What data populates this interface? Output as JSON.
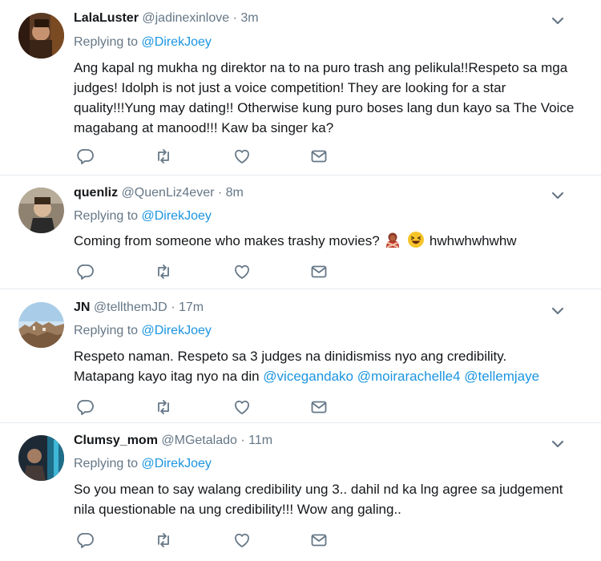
{
  "tweets": [
    {
      "name": "LalaLuster",
      "handle": "@jadinexinlove",
      "separator": "·",
      "time": "3m",
      "replying_prefix": "Replying to",
      "replying_to": "@DirekJoey",
      "text": "Ang kapal ng mukha ng direktor na to na puro trash ang pelikula!!Respeto sa mga judges! Idolph is not just a voice competition! They are looking for a star quality!!!Yung may dating!! Otherwise kung puro boses lang dun kayo sa The Voice magabang at manood!!! Kaw ba singer ka?"
    },
    {
      "name": "quenliz",
      "handle": "@QuenLiz4ever",
      "separator": "·",
      "time": "8m",
      "replying_prefix": "Replying to",
      "replying_to": "@DirekJoey",
      "text_before": "Coming from someone who makes trashy movies?",
      "emojis": [
        "no-gesture-emoji",
        "laughing-emoji"
      ],
      "text_after": "hwhwhwhwhw"
    },
    {
      "name": "JN",
      "handle": "@tellthemJD",
      "separator": "·",
      "time": "17m",
      "replying_prefix": "Replying to",
      "replying_to": "@DirekJoey",
      "text_line1": "Respeto naman. Respeto sa 3 judges na dinidismiss nyo ang credibility.",
      "text_line2": "Matapang kayo itag nyo na din",
      "mentions": [
        "@vicegandako",
        "@moirarachelle4",
        "@tellemjaye"
      ]
    },
    {
      "name": "Clumsy_mom",
      "handle": "@MGetalado",
      "separator": "·",
      "time": "11m",
      "replying_prefix": "Replying to",
      "replying_to": "@DirekJoey",
      "text": "So you mean to say walang credibility ung 3.. dahil nd ka lng agree sa judgement nila questionable na ung credibility!!! Wow ang galing.."
    }
  ],
  "icons": {
    "reply": "reply-icon",
    "retweet": "retweet-icon",
    "like": "like-icon",
    "message": "direct-message-icon",
    "menu": "chevron-down-icon"
  },
  "colors": {
    "link": "#1b95e0",
    "secondary_text": "#657786",
    "divider": "#e6ecf0"
  }
}
